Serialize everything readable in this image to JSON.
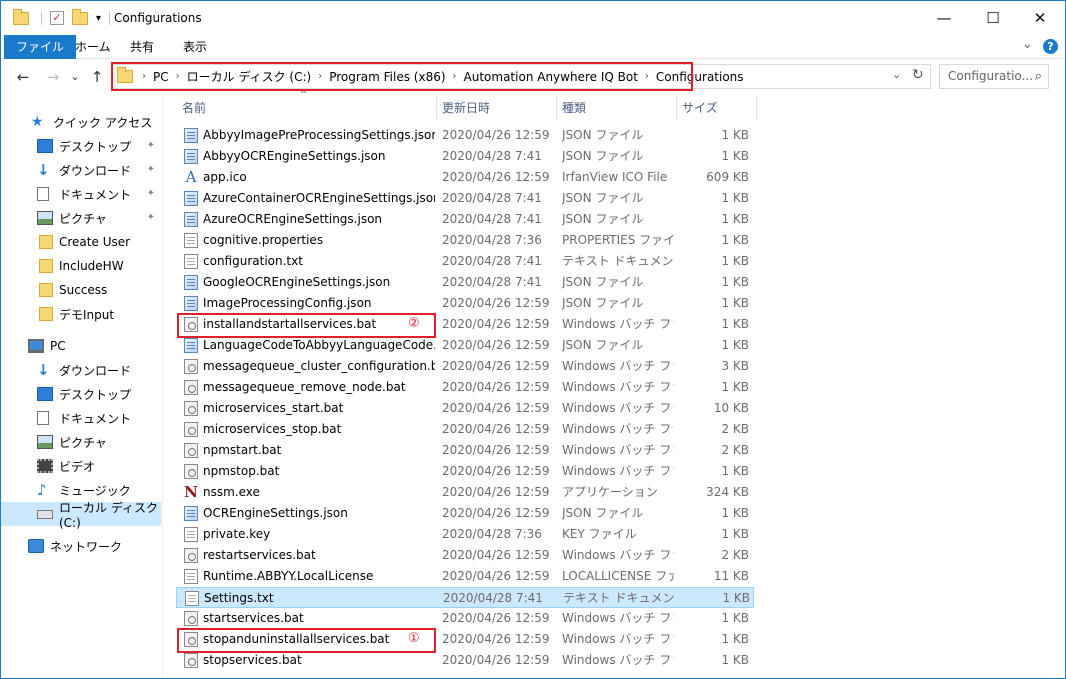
{
  "window": {
    "title": "Configurations",
    "minimize": "—",
    "maximize": "☐",
    "close": "✕"
  },
  "ribbon": {
    "tabs": [
      "ファイル",
      "ホーム",
      "共有",
      "表示"
    ],
    "expand": "⌄",
    "help": "?"
  },
  "address": {
    "back": "←",
    "forward": "→",
    "dropdown": "⌄",
    "up": "↑",
    "crumbs": [
      "PC",
      "ローカル ディスク (C:)",
      "Program Files (x86)",
      "Automation Anywhere IQ Bot",
      "Configurations"
    ],
    "separator": "›",
    "refresh": "↻",
    "search_placeholder": "Configuratio...",
    "search_icon": "⌕"
  },
  "sidebar": {
    "items": [
      {
        "label": "クイック アクセス",
        "icon": "star-icon"
      },
      {
        "label": "デスクトップ",
        "icon": "desktop-icon",
        "pinned": true
      },
      {
        "label": "ダウンロード",
        "icon": "download-icon",
        "pinned": true
      },
      {
        "label": "ドキュメント",
        "icon": "document-icon",
        "pinned": true
      },
      {
        "label": "ピクチャ",
        "icon": "pictures-icon",
        "pinned": true
      },
      {
        "label": "Create User",
        "icon": "folder-icon"
      },
      {
        "label": "IncludeHW",
        "icon": "folder-icon"
      },
      {
        "label": "Success",
        "icon": "folder-icon"
      },
      {
        "label": "デモInput",
        "icon": "folder-icon"
      },
      {
        "label": "PC",
        "icon": "pc-icon"
      },
      {
        "label": "ダウンロード",
        "icon": "download-icon"
      },
      {
        "label": "デスクトップ",
        "icon": "desktop-icon"
      },
      {
        "label": "ドキュメント",
        "icon": "document-icon"
      },
      {
        "label": "ピクチャ",
        "icon": "pictures-icon"
      },
      {
        "label": "ビデオ",
        "icon": "video-icon"
      },
      {
        "label": "ミュージック",
        "icon": "music-icon"
      },
      {
        "label": "ローカル ディスク (C:)",
        "icon": "drive-icon",
        "selected": true
      },
      {
        "label": "ネットワーク",
        "icon": "network-icon"
      }
    ],
    "pin_glyph": "📌"
  },
  "columns": {
    "name": "名前",
    "date": "更新日時",
    "type": "種類",
    "size": "サイズ",
    "sort_glyph": "^"
  },
  "files": [
    {
      "name": "AbbyyImagePreProcessingSettings.json",
      "date": "2020/04/26 12:59",
      "type": "JSON ファイル",
      "size": "1 KB",
      "icon": "json"
    },
    {
      "name": "AbbyyOCREngineSettings.json",
      "date": "2020/04/28 7:41",
      "type": "JSON ファイル",
      "size": "1 KB",
      "icon": "json"
    },
    {
      "name": "app.ico",
      "date": "2020/04/26 12:59",
      "type": "IrfanView ICO File",
      "size": "609 KB",
      "icon": "ico"
    },
    {
      "name": "AzureContainerOCREngineSettings.json",
      "date": "2020/04/28 7:41",
      "type": "JSON ファイル",
      "size": "1 KB",
      "icon": "json"
    },
    {
      "name": "AzureOCREngineSettings.json",
      "date": "2020/04/28 7:41",
      "type": "JSON ファイル",
      "size": "1 KB",
      "icon": "json"
    },
    {
      "name": "cognitive.properties",
      "date": "2020/04/28 7:36",
      "type": "PROPERTIES ファイル",
      "size": "1 KB",
      "icon": "doc"
    },
    {
      "name": "configuration.txt",
      "date": "2020/04/28 7:41",
      "type": "テキスト ドキュメント",
      "size": "1 KB",
      "icon": "doc"
    },
    {
      "name": "GoogleOCREngineSettings.json",
      "date": "2020/04/28 7:41",
      "type": "JSON ファイル",
      "size": "1 KB",
      "icon": "json"
    },
    {
      "name": "ImageProcessingConfig.json",
      "date": "2020/04/26 12:59",
      "type": "JSON ファイル",
      "size": "1 KB",
      "icon": "json"
    },
    {
      "name": "installandstartallservices.bat",
      "date": "2020/04/26 12:59",
      "type": "Windows バッチ ファ...",
      "size": "1 KB",
      "icon": "bat"
    },
    {
      "name": "LanguageCodeToAbbyyLanguageCode.json",
      "date": "2020/04/26 12:59",
      "type": "JSON ファイル",
      "size": "1 KB",
      "icon": "json"
    },
    {
      "name": "messagequeue_cluster_configuration.bat",
      "date": "2020/04/26 12:59",
      "type": "Windows バッチ ファ...",
      "size": "3 KB",
      "icon": "bat"
    },
    {
      "name": "messagequeue_remove_node.bat",
      "date": "2020/04/26 12:59",
      "type": "Windows バッチ ファ...",
      "size": "1 KB",
      "icon": "bat"
    },
    {
      "name": "microservices_start.bat",
      "date": "2020/04/26 12:59",
      "type": "Windows バッチ ファ...",
      "size": "10 KB",
      "icon": "bat"
    },
    {
      "name": "microservices_stop.bat",
      "date": "2020/04/26 12:59",
      "type": "Windows バッチ ファ...",
      "size": "2 KB",
      "icon": "bat"
    },
    {
      "name": "npmstart.bat",
      "date": "2020/04/26 12:59",
      "type": "Windows バッチ ファ...",
      "size": "2 KB",
      "icon": "bat"
    },
    {
      "name": "npmstop.bat",
      "date": "2020/04/26 12:59",
      "type": "Windows バッチ ファ...",
      "size": "1 KB",
      "icon": "bat"
    },
    {
      "name": "nssm.exe",
      "date": "2020/04/26 12:59",
      "type": "アプリケーション",
      "size": "324 KB",
      "icon": "exe"
    },
    {
      "name": "OCREngineSettings.json",
      "date": "2020/04/26 12:59",
      "type": "JSON ファイル",
      "size": "1 KB",
      "icon": "json"
    },
    {
      "name": "private.key",
      "date": "2020/04/28 7:36",
      "type": "KEY ファイル",
      "size": "1 KB",
      "icon": "doc"
    },
    {
      "name": "restartservices.bat",
      "date": "2020/04/26 12:59",
      "type": "Windows バッチ ファ...",
      "size": "2 KB",
      "icon": "bat"
    },
    {
      "name": "Runtime.ABBYY.LocalLicense",
      "date": "2020/04/26 12:59",
      "type": "LOCALLICENSE ファ...",
      "size": "11 KB",
      "icon": "doc"
    },
    {
      "name": "Settings.txt",
      "date": "2020/04/28 7:41",
      "type": "テキスト ドキュメント",
      "size": "1 KB",
      "icon": "doc",
      "selected": true
    },
    {
      "name": "startservices.bat",
      "date": "2020/04/26 12:59",
      "type": "Windows バッチ ファ...",
      "size": "1 KB",
      "icon": "bat"
    },
    {
      "name": "stopanduninstallallservices.bat",
      "date": "2020/04/26 12:59",
      "type": "Windows バッチ ファ...",
      "size": "1 KB",
      "icon": "bat"
    },
    {
      "name": "stopservices.bat",
      "date": "2020/04/26 12:59",
      "type": "Windows バッチ ファ...",
      "size": "1 KB",
      "icon": "bat"
    }
  ],
  "annotations": {
    "marker_1": "①",
    "marker_2": "②",
    "accent": "#e0202a"
  }
}
